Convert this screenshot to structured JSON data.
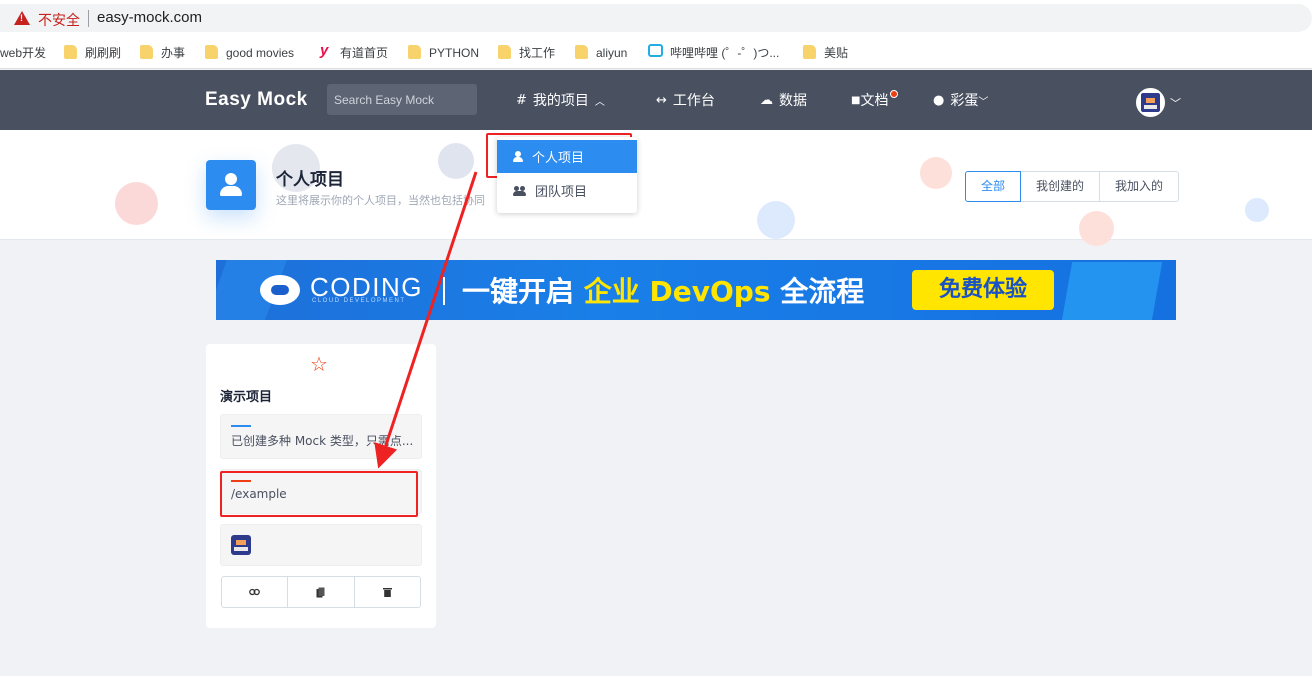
{
  "browser": {
    "security_label": "不安全",
    "url": "easy-mock.com",
    "bookmarks": [
      {
        "label": "web开发",
        "icon": "folder-icon"
      },
      {
        "label": "刷刷刷",
        "icon": "folder-icon"
      },
      {
        "label": "办事",
        "icon": "folder-icon"
      },
      {
        "label": "good movies",
        "icon": "folder-icon"
      },
      {
        "label": "有道首页",
        "icon": "youdao-icon"
      },
      {
        "label": "PYTHON",
        "icon": "folder-icon"
      },
      {
        "label": "找工作",
        "icon": "folder-icon"
      },
      {
        "label": "aliyun",
        "icon": "folder-icon"
      },
      {
        "label": "哔哩哔哩 (゜-゜)つ...",
        "icon": "bilibili-icon"
      },
      {
        "label": "美贴",
        "icon": "folder-icon"
      }
    ]
  },
  "navbar": {
    "logo": "Easy Mock",
    "search_placeholder": "Search Easy Mock",
    "items": [
      {
        "label": "我的项目",
        "icon": "hash-icon"
      },
      {
        "label": "工作台",
        "icon": "code-icon"
      },
      {
        "label": "数据",
        "icon": "cloud-icon"
      },
      {
        "label": "文档",
        "icon": "book-icon"
      },
      {
        "label": "彩蛋",
        "icon": "egg-icon"
      }
    ]
  },
  "dropdown": {
    "items": [
      {
        "label": "个人项目",
        "icon": "person-icon",
        "selected": true
      },
      {
        "label": "团队项目",
        "icon": "people-icon",
        "selected": false
      }
    ]
  },
  "header": {
    "title": "个人项目",
    "subtitle": "这里将展示你的个人项目，当然也包括协同",
    "filters": [
      "全部",
      "我创建的",
      "我加入的"
    ],
    "active_filter": "全部"
  },
  "banner": {
    "brand": "CODING",
    "brand_sub": "CLOUD DEVELOPMENT",
    "slogan_pre": "一键开启",
    "slogan_highlight": "企业 DevOps",
    "slogan_post": "全流程",
    "cta": "免费体验"
  },
  "project_card": {
    "title": "演示项目",
    "description": "已创建多种 Mock 类型，只需点...",
    "base_url": "/example",
    "actions": [
      "link-icon",
      "copy-icon",
      "trash-icon"
    ]
  },
  "colors": {
    "navbar": "#495060",
    "primary": "#2d8cf0",
    "annotation": "#ee2222",
    "banner_highlight": "#ffe500"
  }
}
